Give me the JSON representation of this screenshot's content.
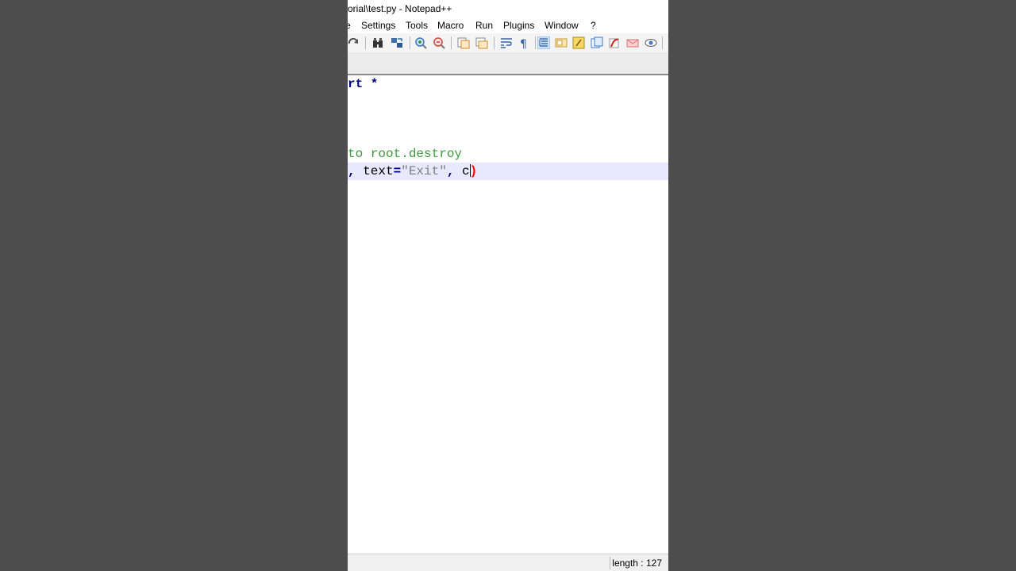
{
  "window": {
    "title": "orial\\test.py - Notepad++"
  },
  "menu": {
    "items": [
      "e",
      "Settings",
      "Tools",
      "Macro",
      "Run",
      "Plugins",
      "Window",
      "?"
    ]
  },
  "toolbar": {
    "icons": [
      "redo-icon",
      "find-icon",
      "replace-icon",
      "zoom-in-icon",
      "zoom-out-icon",
      "sync-vertical-icon",
      "sync-horizontal-icon",
      "word-wrap-icon",
      "show-all-chars-icon",
      "indent-guide-icon",
      "doc-map-icon",
      "function-list-icon",
      "folder-workspace-icon",
      "macro-record-icon",
      "macro-stop-icon",
      "monitor-icon"
    ]
  },
  "editor": {
    "lines": [
      {
        "parts": [
          {
            "t": "rt *",
            "c": "kw"
          }
        ]
      },
      {
        "parts": []
      },
      {
        "parts": []
      },
      {
        "parts": []
      },
      {
        "parts": [
          {
            "t": "to root.destroy",
            "c": "cm"
          }
        ]
      },
      {
        "parts": [
          {
            "t": ", ",
            "c": "op"
          },
          {
            "t": "text",
            "c": "id"
          },
          {
            "t": "=",
            "c": "op"
          },
          {
            "t": "\"Exit\"",
            "c": "str"
          },
          {
            "t": ", ",
            "c": "op"
          },
          {
            "t": "c",
            "c": "id"
          }
        ],
        "brace": ")"
      }
    ]
  },
  "status": {
    "length_text": "length : 127"
  }
}
